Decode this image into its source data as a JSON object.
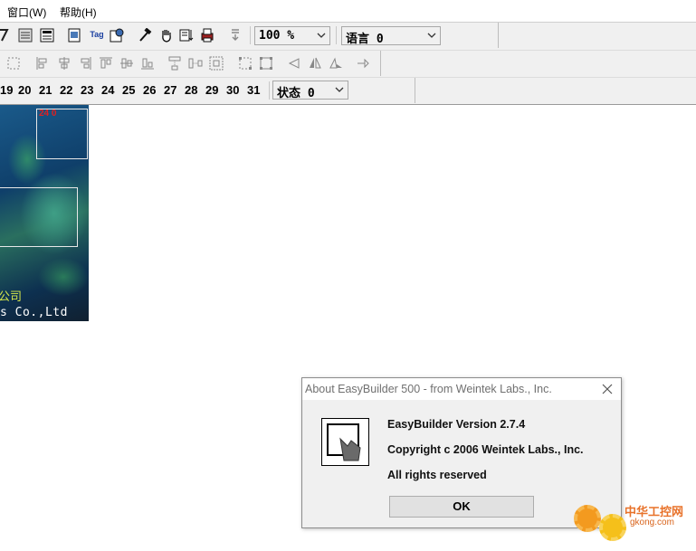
{
  "menu": {
    "items": [
      "窗口(W)",
      "帮助(H)"
    ]
  },
  "toolbar": {
    "zoom": "100 %",
    "language": "语言 0",
    "status": "状态 0",
    "tag_label": "Tag",
    "numbers": [
      "19",
      "20",
      "21",
      "22",
      "23",
      "24",
      "25",
      "26",
      "27",
      "28",
      "29",
      "30",
      "31"
    ]
  },
  "canvas": {
    "chinese_text": "公司",
    "english_text": "s Co.,Ltd",
    "red_text": "24 0"
  },
  "dialog": {
    "title": "About EasyBuilder 500 - from Weintek Labs., Inc.",
    "version": "EasyBuilder Version 2.7.4",
    "copyright": "Copyright c 2006  Weintek Labs., Inc.",
    "rights": "All rights reserved",
    "ok_label": "OK"
  },
  "watermark": {
    "cn": "中华工控网",
    "en": "gkong.com"
  },
  "colors": {
    "dialog_bg": "#f0f0f0",
    "toolbar_bg": "#f0f0f0",
    "watermark": "#e8722a"
  }
}
